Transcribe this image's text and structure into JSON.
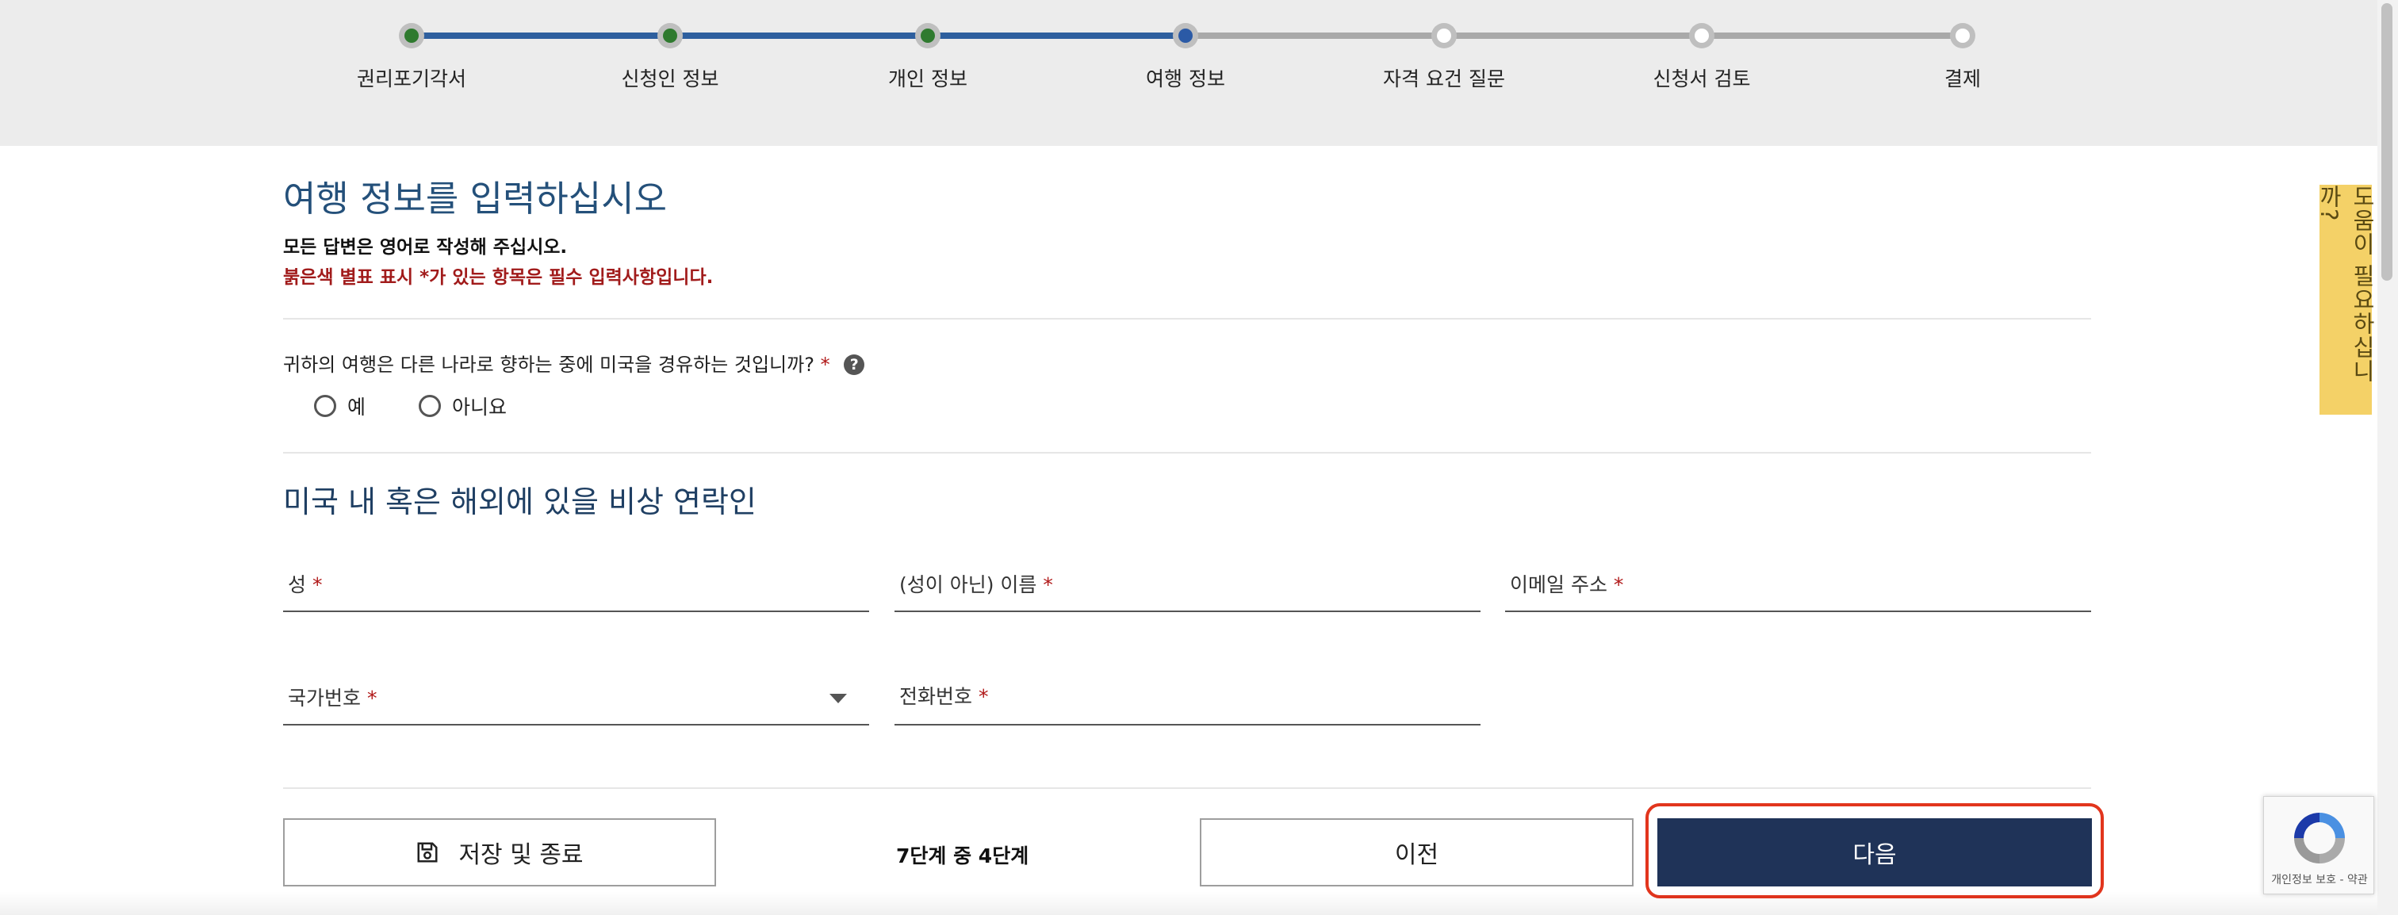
{
  "progress": {
    "steps": [
      {
        "label": "권리포기각서",
        "state": "done"
      },
      {
        "label": "신청인 정보",
        "state": "done"
      },
      {
        "label": "개인 정보",
        "state": "done"
      },
      {
        "label": "여행 정보",
        "state": "current"
      },
      {
        "label": "자격 요건 질문",
        "state": "todo"
      },
      {
        "label": "신청서 검토",
        "state": "todo"
      },
      {
        "label": "결제",
        "state": "todo"
      }
    ]
  },
  "page": {
    "title": "여행 정보를 입력하십시오",
    "notice_english": "모든 답변은 영어로 작성해 주십시오.",
    "notice_required": "붉은색 별표 표시 *가 있는 항목은 필수 입력사항입니다."
  },
  "transit_question": {
    "text": "귀하의 여행은 다른 나라로 향하는 중에 미국을 경유하는 것입니까?",
    "required_mark": "*",
    "help_glyph": "?",
    "options": [
      "예",
      "아니요"
    ]
  },
  "emergency_contact": {
    "title": "미국 내 혹은 해외에 있을 비상 연락인",
    "fields": {
      "last_name": "성",
      "first_name": "(성이 아닌) 이름",
      "email": "이메일 주소",
      "country_code": "국가번호",
      "phone": "전화번호"
    },
    "required_mark": "*"
  },
  "footer": {
    "save_exit": "저장 및 종료",
    "step_count": "7단계 중 4단계",
    "previous": "이전",
    "next": "다음"
  },
  "help_tab": "도움이 필요하십니까?",
  "recaptcha": {
    "text": "개인정보 보호 - 약관"
  },
  "colors": {
    "accent_navy": "#1f3358",
    "title_blue": "#24507a",
    "required_red": "#b01818",
    "highlight_red": "#e2351d",
    "help_yellow": "#f4d167",
    "progress_done": "#2e5f9e"
  }
}
